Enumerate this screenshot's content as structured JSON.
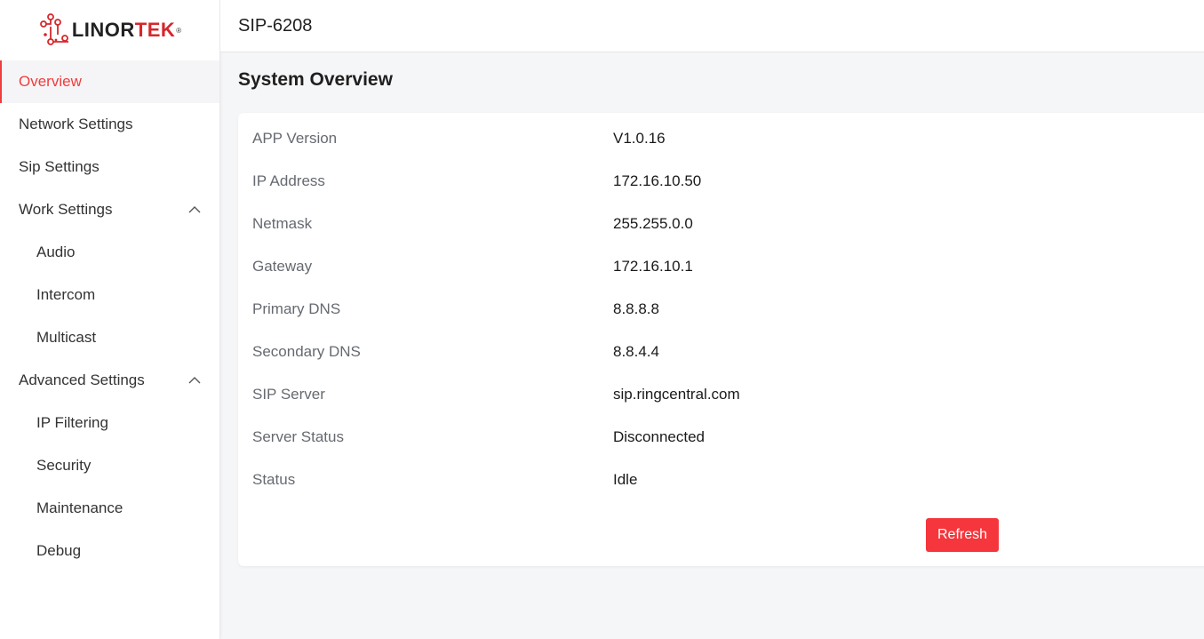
{
  "brand": {
    "logo_text_left": "LINOR",
    "logo_text_right": "TEK",
    "logo_mark": "®",
    "accent_color": "#f03c3c"
  },
  "header": {
    "title": "SIP-6208"
  },
  "sidebar": {
    "items": [
      {
        "label": "Overview",
        "active": true
      },
      {
        "label": "Network Settings"
      },
      {
        "label": "Sip Settings"
      },
      {
        "label": "Work Settings",
        "expanded": true,
        "icon": "chevron-up-icon"
      },
      {
        "label": "Audio"
      },
      {
        "label": "Intercom"
      },
      {
        "label": "Multicast"
      },
      {
        "label": "Advanced Settings",
        "expanded": true,
        "icon": "chevron-up-icon"
      },
      {
        "label": "IP Filtering"
      },
      {
        "label": "Security"
      },
      {
        "label": "Maintenance"
      },
      {
        "label": "Debug"
      }
    ]
  },
  "main": {
    "title": "System Overview",
    "rows": [
      {
        "label": "APP Version",
        "value": "V1.0.16"
      },
      {
        "label": "IP Address",
        "value": "172.16.10.50"
      },
      {
        "label": "Netmask",
        "value": "255.255.0.0"
      },
      {
        "label": "Gateway",
        "value": "172.16.10.1"
      },
      {
        "label": "Primary DNS",
        "value": "8.8.8.8"
      },
      {
        "label": "Secondary DNS",
        "value": "8.8.4.4"
      },
      {
        "label": "SIP Server",
        "value": "sip.ringcentral.com"
      },
      {
        "label": "Server Status",
        "value": "Disconnected"
      },
      {
        "label": "Status",
        "value": "Idle"
      }
    ],
    "refresh_label": "Refresh",
    "button_color": "#f5363c"
  }
}
